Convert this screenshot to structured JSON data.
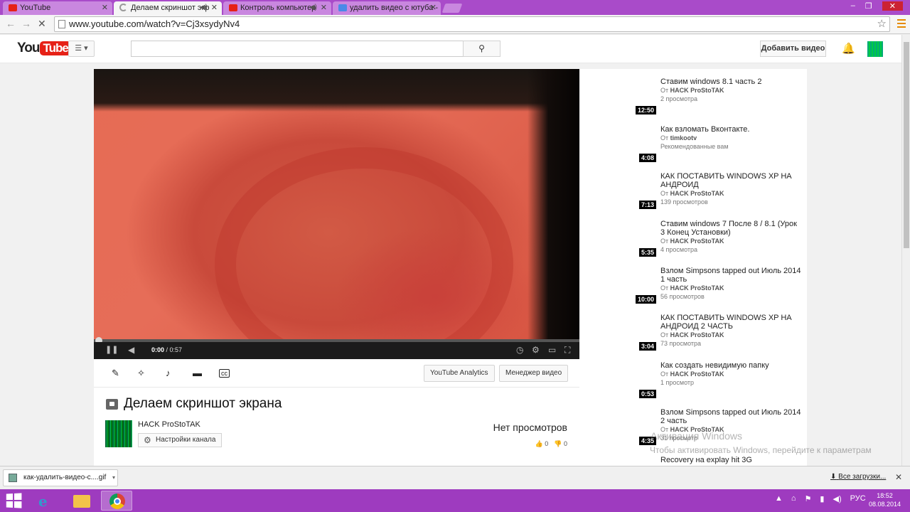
{
  "browser": {
    "tabs": [
      {
        "label": "YouTube",
        "icon": "youtube-favicon"
      },
      {
        "label": "Делаем скриншот экр",
        "icon": "loading-spinner"
      },
      {
        "label": "Контроль компьютер",
        "icon": "youtube-favicon"
      },
      {
        "label": "удалить видео с ютуба - ",
        "icon": "google-favicon"
      }
    ],
    "url": "www.youtube.com/watch?v=Cj3xsydyNv4"
  },
  "yt": {
    "logo_you": "You",
    "logo_tube": "Tube",
    "logo_region": "RU",
    "upload_label": "Добавить видео",
    "search_value": ""
  },
  "player": {
    "time_current": "0:00",
    "time_total": "/ 0:57",
    "progress": 0.0
  },
  "editor": {
    "analytics_label": "YouTube Analytics",
    "manager_label": "Менеджер видео"
  },
  "video": {
    "title": "Делаем скриншот экрана",
    "channel": "HACK ProStoTAK",
    "channel_settings": "Настройки канала",
    "views": "Нет просмотров",
    "likes": "0",
    "dislikes": "0"
  },
  "related": [
    {
      "title": "Ставим windows 8.1 часть 2",
      "by": "От",
      "author": "HACK ProStoTAK",
      "meta": "2 просмотра",
      "duration": "12:50"
    },
    {
      "title": "Как взломать Вконтакте.",
      "by": "От",
      "author": "timkootv",
      "meta": "Рекомендованные вам",
      "duration": "4:08"
    },
    {
      "title": "КАК ПОСТАВИТЬ WINDOWS XP НА АНДРОИД",
      "by": "От",
      "author": "HACK ProStoTAK",
      "meta": "139 просмотров",
      "duration": "7:13"
    },
    {
      "title": "Ставим windows 7 После 8 / 8.1 (Урок 3 Конец Установки)",
      "by": "От",
      "author": "HACK ProStoTAK",
      "meta": "4 просмотра",
      "duration": "5:35"
    },
    {
      "title": "Взлом Simpsons tapped out Июль 2014 1 часть",
      "by": "От",
      "author": "HACK ProStoTAK",
      "meta": "56 просмотров",
      "duration": "10:00"
    },
    {
      "title": "КАК ПОСТАВИТЬ WINDOWS XP НА АНДРОИД 2 ЧАСТЬ",
      "by": "От",
      "author": "HACK ProStoTAK",
      "meta": "73 просмотра",
      "duration": "3:04"
    },
    {
      "title": "Как создать невидимую папку",
      "by": "От",
      "author": "HACK ProStoTAK",
      "meta": "1 просмотр",
      "duration": "0:53"
    },
    {
      "title": "Взлом Simpsons tapped out Июль 2014 2 часть",
      "by": "От",
      "author": "HACK ProStoTAK",
      "meta": "31 просмотр",
      "duration": "4:35"
    },
    {
      "title": "Recovery на explay hit 3G",
      "by": "",
      "author": "",
      "meta": "",
      "duration": ""
    }
  ],
  "watermark": {
    "line1": "Активация Windows",
    "line2": "Чтобы активировать Windows, перейдите к параметрам"
  },
  "downloads": {
    "file": "как-удалить-видео-с....gif",
    "show_all": "Все загрузки..."
  },
  "taskbar": {
    "lang": "РУС",
    "time": "18:52",
    "date": "08.08.2014"
  }
}
